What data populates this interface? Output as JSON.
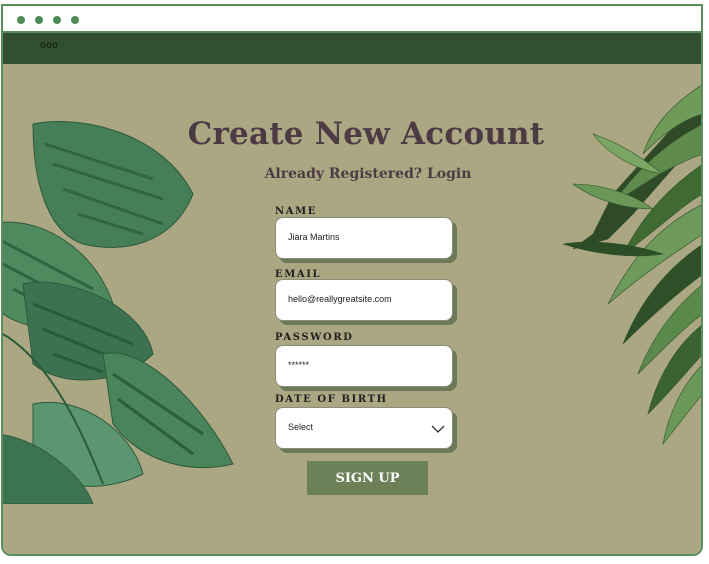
{
  "window": {
    "dots": [
      "dot",
      "dot",
      "dot",
      "dot"
    ],
    "accent_color": "#5a8f5c"
  },
  "navbar": {
    "menu_label": "ooo",
    "background": "#31502f"
  },
  "page": {
    "title": "Create New Account",
    "subtitle": "Already Registered? Login",
    "background": "#aba783"
  },
  "form": {
    "name_label": "NAME",
    "name_value": "Jiara Martins",
    "email_label": "EMAIL",
    "email_value": "hello@reallygreatsite.com",
    "password_label": "PASSWORD",
    "password_value": "******",
    "dob_label": "DATE OF BIRTH",
    "dob_value": "Select",
    "submit_label": "SIGN UP",
    "button_color": "#6c8157"
  },
  "decor": {
    "left_plant_icon": "monstera-leaves-icon",
    "right_plant_icon": "fern-leaves-icon"
  }
}
